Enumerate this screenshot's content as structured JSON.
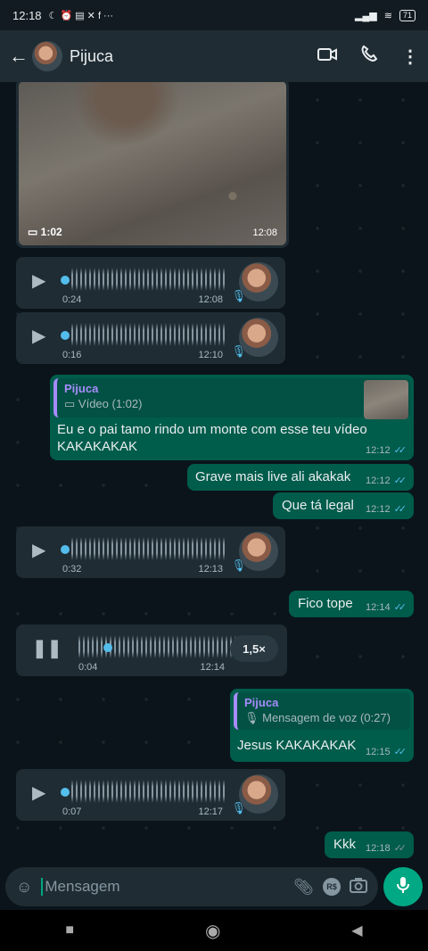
{
  "status_bar": {
    "time": "12:18",
    "icons_left": "☾ ⏰ ▤ ✕ f ···",
    "battery": "71"
  },
  "header": {
    "contact_name": "Pijuca",
    "back_icon": "arrow-left-icon",
    "video_icon": "video-camera-icon",
    "call_icon": "phone-icon",
    "menu_icon": "more-vertical-icon"
  },
  "messages": {
    "video": {
      "duration": "1:02",
      "time": "12:08"
    },
    "voice1": {
      "duration": "0:24",
      "time": "12:08"
    },
    "voice2": {
      "duration": "0:16",
      "time": "12:10"
    },
    "reply1": {
      "quoted_name": "Pijuca",
      "quoted_text": "Vídeo (1:02)",
      "text": "Eu e o pai tamo rindo um monte com esse teu vídeo KAKAKAKAK",
      "time": "12:12"
    },
    "out1": {
      "text": "Grave mais live ali akakak",
      "time": "12:12"
    },
    "out2": {
      "text": "Que tá legal",
      "time": "12:12"
    },
    "voice3": {
      "duration": "0:32",
      "time": "12:13"
    },
    "out3": {
      "text": "Fico tope",
      "time": "12:14"
    },
    "voice4": {
      "duration": "0:04",
      "time": "12:14",
      "speed": "1,5×"
    },
    "reply2": {
      "quoted_name": "Pijuca",
      "quoted_text": "Mensagem de voz (0:27)",
      "text": "Jesus KAKAKAKAK",
      "time": "12:15"
    },
    "voice5": {
      "duration": "0:07",
      "time": "12:17"
    },
    "out4": {
      "text": "Kkk",
      "time": "12:18"
    }
  },
  "input": {
    "placeholder": "Mensagem"
  },
  "colors": {
    "incoming": "#1f2c34",
    "outgoing": "#005c4b",
    "accent": "#00a884",
    "read_ticks": "#53bdeb"
  }
}
